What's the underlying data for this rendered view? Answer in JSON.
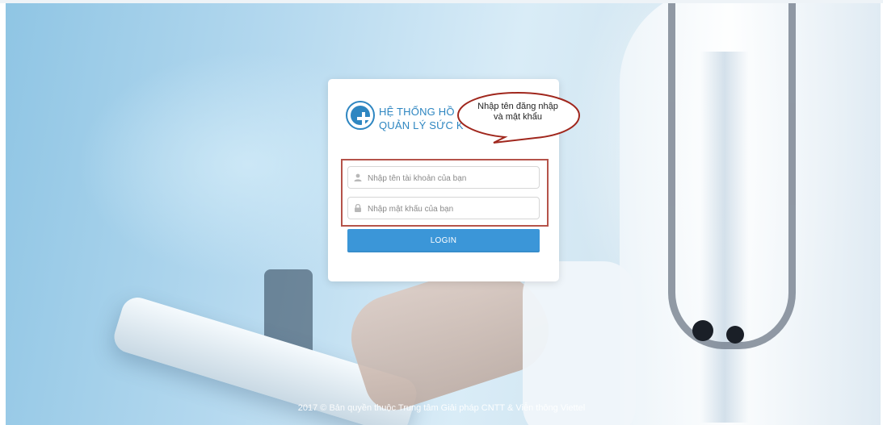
{
  "login": {
    "title_line1": "HỆ THỐNG HỒ",
    "title_line2": "QUẢN LÝ SỨC K",
    "username_placeholder": "Nhập tên tài khoản của bạn",
    "password_placeholder": "Nhập mật khẩu của bạn",
    "login_label": "LOGIN"
  },
  "callout": {
    "line1": "Nhập tên đăng nhập",
    "line2": "và mật khẩu"
  },
  "footer": {
    "text": "2017 © Bản quyền thuộc Trung tâm Giải pháp CNTT & Viễn thông Viettel"
  },
  "colors": {
    "accent": "#2e86c1",
    "button": "#3b96d8",
    "highlight": "#b5534a",
    "callout_border": "#a0271d"
  },
  "icons": {
    "logo": "medical-cross-icon",
    "username": "user-icon",
    "password": "lock-icon"
  }
}
